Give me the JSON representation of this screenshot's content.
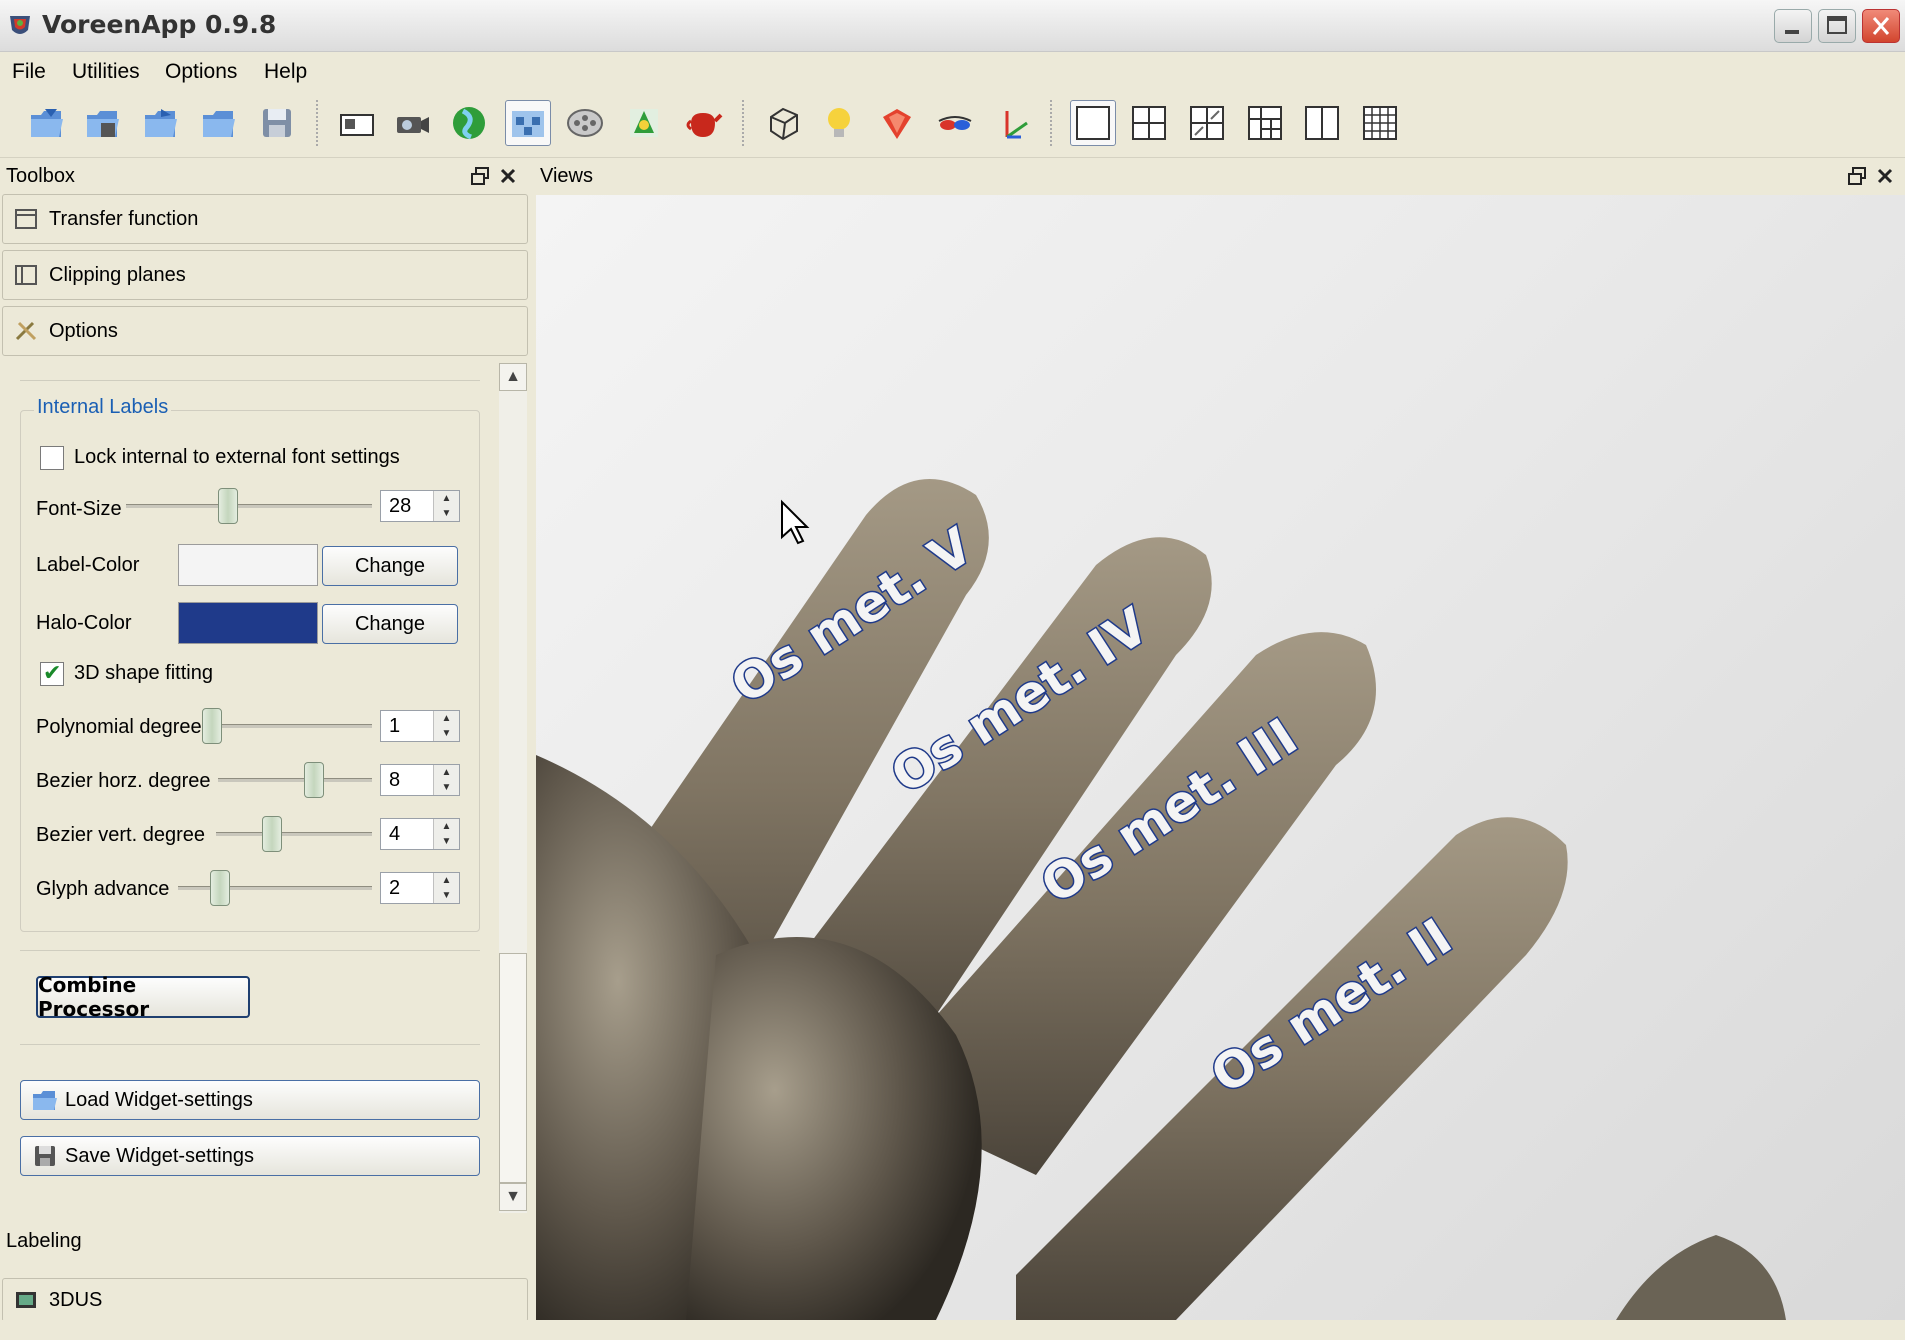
{
  "window": {
    "title": "VoreenApp 0.9.8"
  },
  "menu": [
    "File",
    "Utilities",
    "Options",
    "Help"
  ],
  "toolbar": {
    "icons": [
      "open-volume-icon",
      "open-dicom-icon",
      "open-workspace-icon",
      "open-file-icon",
      "save-icon",
      "snapshot-icon",
      "camera-icon",
      "globe-icon",
      "network-icon",
      "film-icon",
      "shader-icon",
      "teapot-icon",
      "bounding-box-icon",
      "light-bulb-icon",
      "material-gem-icon",
      "stereo-glasses-icon",
      "axes-icon",
      "layout-single-icon",
      "layout-2x2-icon",
      "layout-3d-quad-icon",
      "layout-grid-icon",
      "layout-split-icon",
      "layout-many-icon"
    ]
  },
  "toolbox": {
    "title": "Toolbox",
    "sections": {
      "transfer_function": "Transfer function",
      "clipping_planes": "Clipping planes",
      "options": "Options",
      "labeling": "Labeling",
      "threedus": "3DUS"
    },
    "internal_labels": {
      "title": "Internal Labels",
      "lock_label": "Lock internal to external font settings",
      "lock_checked": false,
      "font_size_label": "Font-Size",
      "font_size_value": "28",
      "font_size_level": 0.4,
      "label_color_label": "Label-Color",
      "label_color": "#f4f4f4",
      "halo_color_label": "Halo-Color",
      "halo_color": "#1f3a8a",
      "change_label": "Change",
      "shape_fitting_label": "3D shape fitting",
      "shape_fitting_checked": true,
      "poly_label": "Polynomial degree",
      "poly_value": "1",
      "bezier_h_label": "Bezier horz. degree",
      "bezier_h_value": "8",
      "bezier_v_label": "Bezier vert. degree",
      "bezier_v_value": "4",
      "glyph_label": "Glyph advance",
      "glyph_value": "2"
    },
    "combine_label": "Combine Processor",
    "load_label": "Load Widget-settings",
    "save_label": "Save Widget-settings"
  },
  "views": {
    "title": "Views",
    "labels": [
      "Os met. V",
      "Os met. IV",
      "Os met. III",
      "Os met. II"
    ]
  },
  "colors": {
    "halo": "#1f3a8a",
    "label": "#f4f4f4",
    "accent": "#1a5fb4"
  }
}
